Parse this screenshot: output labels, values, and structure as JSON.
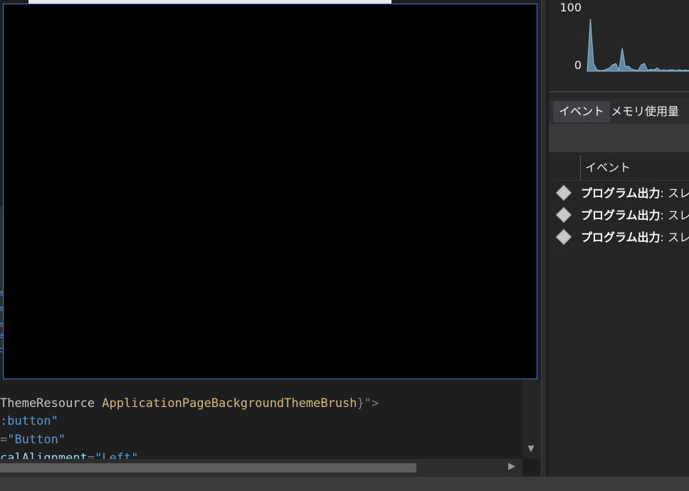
{
  "editor": {
    "code_lines": [
      {
        "segments": [
          {
            "text": "ThemeResource ",
            "style": "c-kw"
          },
          {
            "text": "ApplicationPageBackgroundThemeBrush",
            "style": "c-res"
          },
          {
            "text": "}\">",
            "style": "c-sym"
          }
        ]
      },
      {
        "segments": [
          {
            "text": ":button\"",
            "style": "c-val"
          }
        ]
      },
      {
        "segments": [
          {
            "text": "=",
            "style": "c-sym"
          },
          {
            "text": "\"Button\"",
            "style": "c-val"
          }
        ]
      },
      {
        "segments": [
          {
            "text": "calAlignment",
            "style": "c-attr"
          },
          {
            "text": "=",
            "style": "c-sym"
          },
          {
            "text": "\"Left\"",
            "style": "c-val"
          }
        ]
      }
    ],
    "edge_glyphs": [
      "e",
      "e",
      "e",
      "e",
      "c"
    ],
    "scroll_down_icon": "▼",
    "scroll_right_icon": "▶"
  },
  "diagnostics": {
    "cpu_chart": {
      "y_top_label": "100",
      "y_bottom_label": "0"
    },
    "tabs": [
      {
        "label": "イベント",
        "selected": true
      },
      {
        "label": "メモリ使用量",
        "selected": false
      }
    ],
    "list_header": "イベント",
    "events": [
      {
        "category": "プログラム出力",
        "text": ": スレッ"
      },
      {
        "category": "プログラム出力",
        "text": ": スレッ"
      },
      {
        "category": "プログラム出力",
        "text": ": スレッ"
      }
    ]
  },
  "chart_data": {
    "type": "area",
    "title": "",
    "xlabel": "",
    "ylabel": "",
    "ylim": [
      0,
      100
    ],
    "yticks": [
      "100",
      "0"
    ],
    "series": [
      {
        "values": [
          0,
          82,
          12,
          2,
          1,
          1,
          3,
          5,
          10,
          12,
          2,
          36,
          7,
          8,
          3,
          2,
          1,
          10,
          12,
          1,
          3,
          2,
          5,
          1,
          2,
          1,
          2,
          2,
          1,
          2,
          1,
          2,
          1
        ],
        "color": "#6b9ab8"
      }
    ]
  }
}
